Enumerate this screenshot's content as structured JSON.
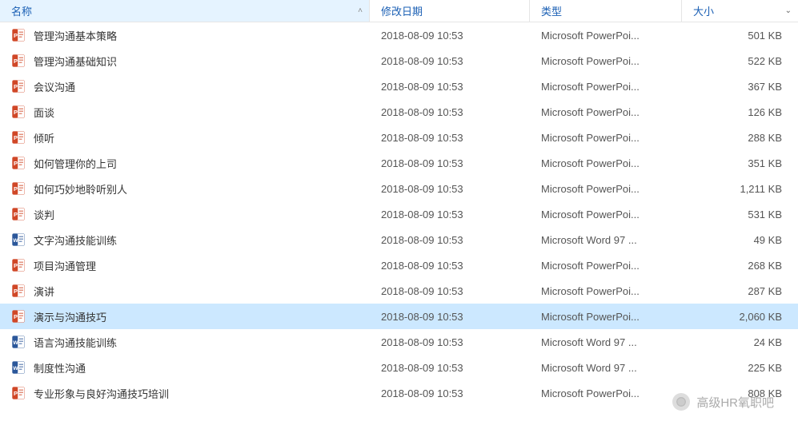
{
  "columns": {
    "name": "名称",
    "date": "修改日期",
    "type": "类型",
    "size": "大小"
  },
  "files": [
    {
      "name": "管理沟通基本策略",
      "date": "2018-08-09 10:53",
      "type": "Microsoft PowerPoi...",
      "size": "501 KB",
      "icon": "ppt"
    },
    {
      "name": "管理沟通基础知识",
      "date": "2018-08-09 10:53",
      "type": "Microsoft PowerPoi...",
      "size": "522 KB",
      "icon": "ppt"
    },
    {
      "name": "会议沟通",
      "date": "2018-08-09 10:53",
      "type": "Microsoft PowerPoi...",
      "size": "367 KB",
      "icon": "ppt"
    },
    {
      "name": "面谈",
      "date": "2018-08-09 10:53",
      "type": "Microsoft PowerPoi...",
      "size": "126 KB",
      "icon": "ppt"
    },
    {
      "name": "倾听",
      "date": "2018-08-09 10:53",
      "type": "Microsoft PowerPoi...",
      "size": "288 KB",
      "icon": "ppt"
    },
    {
      "name": "如何管理你的上司",
      "date": "2018-08-09 10:53",
      "type": "Microsoft PowerPoi...",
      "size": "351 KB",
      "icon": "ppt"
    },
    {
      "name": "如何巧妙地聆听别人",
      "date": "2018-08-09 10:53",
      "type": "Microsoft PowerPoi...",
      "size": "1,211 KB",
      "icon": "ppt"
    },
    {
      "name": "谈判",
      "date": "2018-08-09 10:53",
      "type": "Microsoft PowerPoi...",
      "size": "531 KB",
      "icon": "ppt"
    },
    {
      "name": "文字沟通技能训练",
      "date": "2018-08-09 10:53",
      "type": "Microsoft Word 97 ...",
      "size": "49 KB",
      "icon": "doc"
    },
    {
      "name": "项目沟通管理",
      "date": "2018-08-09 10:53",
      "type": "Microsoft PowerPoi...",
      "size": "268 KB",
      "icon": "ppt"
    },
    {
      "name": "演讲",
      "date": "2018-08-09 10:53",
      "type": "Microsoft PowerPoi...",
      "size": "287 KB",
      "icon": "ppt"
    },
    {
      "name": "演示与沟通技巧",
      "date": "2018-08-09 10:53",
      "type": "Microsoft PowerPoi...",
      "size": "2,060 KB",
      "icon": "ppt",
      "selected": true
    },
    {
      "name": "语言沟通技能训练",
      "date": "2018-08-09 10:53",
      "type": "Microsoft Word 97 ...",
      "size": "24 KB",
      "icon": "doc"
    },
    {
      "name": "制度性沟通",
      "date": "2018-08-09 10:53",
      "type": "Microsoft Word 97 ...",
      "size": "225 KB",
      "icon": "doc"
    },
    {
      "name": "专业形象与良好沟通技巧培训",
      "date": "2018-08-09 10:53",
      "type": "Microsoft PowerPoi...",
      "size": "808 KB",
      "icon": "ppt"
    }
  ],
  "watermark": {
    "text": "高级HR氧职吧"
  }
}
